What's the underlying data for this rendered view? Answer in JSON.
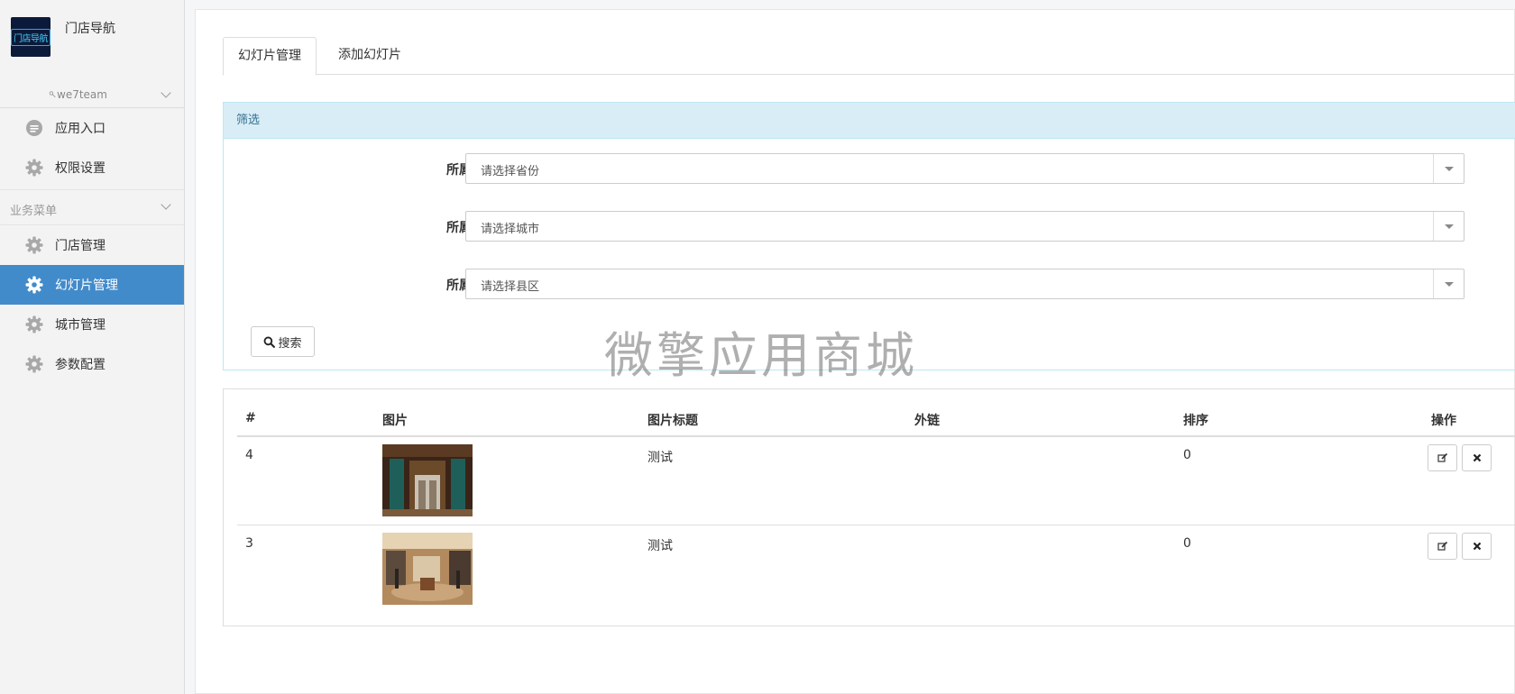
{
  "sidebar": {
    "brand_name": "门店导航",
    "logo_text": "门店导航",
    "account": "we7team",
    "top_items": [
      {
        "label": "应用入口",
        "icon": "chat-icon"
      },
      {
        "label": "权限设置",
        "icon": "gear-icon"
      }
    ],
    "group_label": "业务菜单",
    "menu_items": [
      {
        "label": "门店管理",
        "icon": "gear-icon",
        "active": false
      },
      {
        "label": "幻灯片管理",
        "icon": "gear-icon",
        "active": true
      },
      {
        "label": "城市管理",
        "icon": "gear-icon",
        "active": false
      },
      {
        "label": "参数配置",
        "icon": "gear-icon",
        "active": false
      }
    ]
  },
  "tabs": [
    {
      "label": "幻灯片管理",
      "active": true
    },
    {
      "label": "添加幻灯片",
      "active": false
    }
  ],
  "filter": {
    "heading": "筛选",
    "fields": [
      {
        "label": "所属省份",
        "value": "请选择省份"
      },
      {
        "label": "所属城市",
        "value": "请选择城市"
      },
      {
        "label": "所属县区",
        "value": "请选择县区"
      }
    ],
    "search_label": "搜索"
  },
  "watermark": "微擎应用商城",
  "table": {
    "columns": [
      "#",
      "图片",
      "图片标题",
      "外链",
      "排序",
      "操作"
    ],
    "rows": [
      {
        "id": "4",
        "title": "测试",
        "link": "",
        "order": "0",
        "image": "storefront-photo"
      },
      {
        "id": "3",
        "title": "测试",
        "link": "",
        "order": "0",
        "image": "store-interior-photo"
      }
    ]
  },
  "colors": {
    "active_nav": "#428bca",
    "panel_heading_bg": "#d9edf7",
    "panel_heading_text": "#31708f"
  }
}
